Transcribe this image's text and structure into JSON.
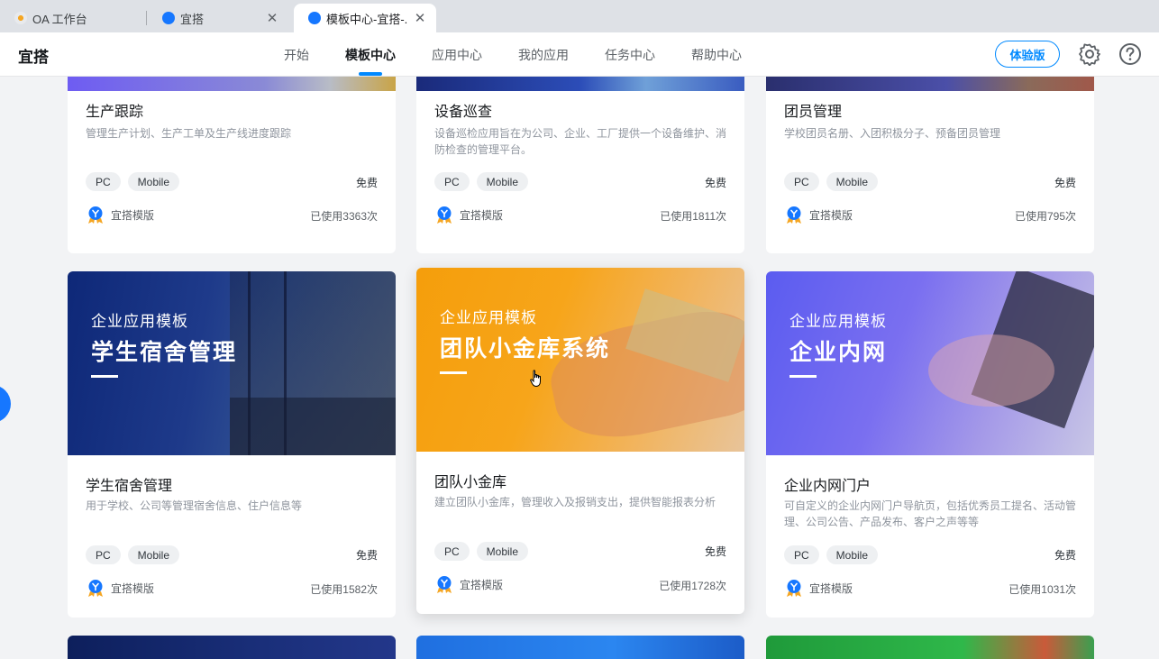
{
  "browser": {
    "tabs": [
      {
        "label": "OA 工作台",
        "active": false,
        "closable": false
      },
      {
        "label": "宜搭",
        "active": false,
        "closable": true
      },
      {
        "label": "模板中心-宜搭-...",
        "active": true,
        "closable": true
      }
    ]
  },
  "header": {
    "brand": "宜搭",
    "nav": [
      "开始",
      "模板中心",
      "应用中心",
      "我的应用",
      "任务中心",
      "帮助中心"
    ],
    "active_nav": "模板中心",
    "trial_label": "体验版",
    "icons": [
      "gear-icon",
      "help-icon"
    ]
  },
  "colors": {
    "accent": "#0089ff",
    "page_bg": "#f2f3f5"
  },
  "cards": [
    {
      "title": "生产跟踪",
      "desc": "管理生产计划、生产工单及生产线进度跟踪",
      "tags": [
        "PC",
        "Mobile"
      ],
      "price": "免费",
      "author": "宜搭模版",
      "usage": "已使用3363次"
    },
    {
      "title": "设备巡查",
      "desc": "设备巡检应用旨在为公司、企业、工厂提供一个设备维护、消防检查的管理平台。",
      "tags": [
        "PC",
        "Mobile"
      ],
      "price": "免费",
      "author": "宜搭模版",
      "usage": "已使用1811次"
    },
    {
      "title": "团员管理",
      "desc": "学校团员名册、入团积极分子、预备团员管理",
      "tags": [
        "PC",
        "Mobile"
      ],
      "price": "免费",
      "author": "宜搭模版",
      "usage": "已使用795次"
    },
    {
      "cover_kicker": "企业应用模板",
      "cover_title": "学生宿舍管理",
      "title": "学生宿舍管理",
      "desc": "用于学校、公司等管理宿舍信息、住户信息等",
      "tags": [
        "PC",
        "Mobile"
      ],
      "price": "免费",
      "author": "宜搭模版",
      "usage": "已使用1582次"
    },
    {
      "cover_kicker": "企业应用模板",
      "cover_title": "团队小金库系统",
      "title": "团队小金库",
      "desc": "建立团队小金库，管理收入及报销支出，提供智能报表分析",
      "tags": [
        "PC",
        "Mobile"
      ],
      "price": "免费",
      "author": "宜搭模版",
      "usage": "已使用1728次"
    },
    {
      "cover_kicker": "企业应用模板",
      "cover_title": "企业内网",
      "title": "企业内网门户",
      "desc": "可自定义的企业内网门户导航页，包括优秀员工提名、活动管理、公司公告、产品发布、客户之声等等",
      "tags": [
        "PC",
        "Mobile"
      ],
      "price": "免费",
      "author": "宜搭模版",
      "usage": "已使用1031次"
    }
  ]
}
